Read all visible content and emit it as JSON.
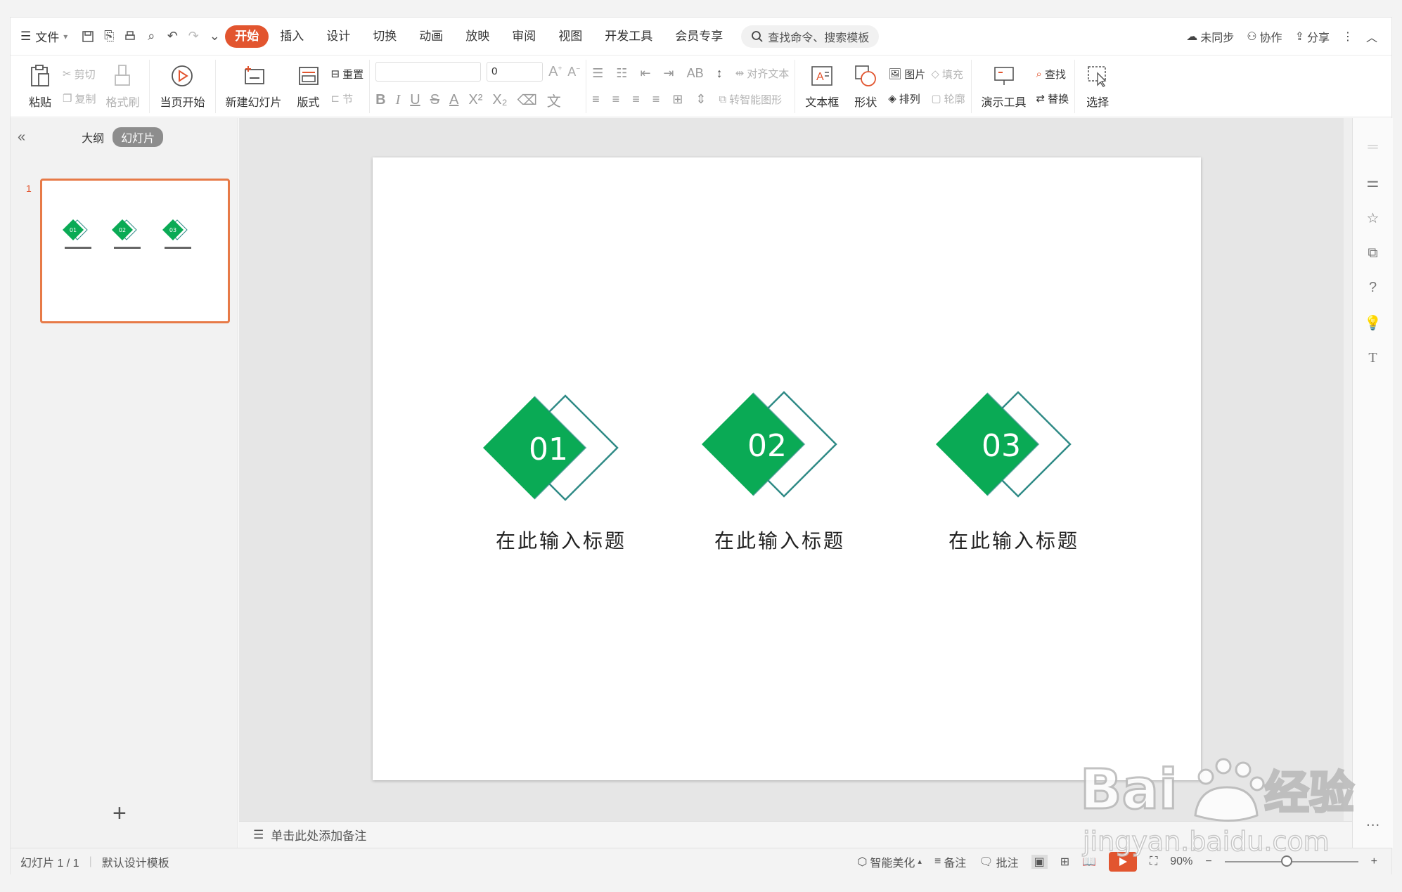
{
  "menubar": {
    "file_label": "文件",
    "tabs": [
      "开始",
      "插入",
      "设计",
      "切换",
      "动画",
      "放映",
      "审阅",
      "视图",
      "开发工具",
      "会员专享"
    ],
    "search_placeholder": "查找命令、搜索模板",
    "sync_label": "未同步",
    "collab_label": "协作",
    "share_label": "分享"
  },
  "ribbon": {
    "paste": "粘贴",
    "cut": "剪切",
    "copy": "复制",
    "format_painter": "格式刷",
    "from_current": "当页开始",
    "new_slide": "新建幻灯片",
    "layout": "版式",
    "reset": "重置",
    "section": "节",
    "font_size_value": "0",
    "align_text": "对齐文本",
    "smart_shape": "转智能图形",
    "textbox": "文本框",
    "shape": "形状",
    "picture": "图片",
    "fill": "填充",
    "arrange": "排列",
    "outline": "轮廓",
    "present_tools": "演示工具",
    "find": "查找",
    "replace": "替换",
    "select": "选择"
  },
  "leftpanel": {
    "outline_tab": "大纲",
    "slides_tab": "幻灯片",
    "slide_number": "1",
    "add_icon": "+"
  },
  "slide": {
    "items": [
      {
        "number": "01",
        "title": "在此输入标题"
      },
      {
        "number": "02",
        "title": "在此输入标题"
      },
      {
        "number": "03",
        "title": "在此输入标题"
      }
    ],
    "colors": {
      "green": "#0aaa55",
      "teal": "#2f8a86"
    }
  },
  "notes": {
    "placeholder": "单击此处添加备注"
  },
  "statusbar": {
    "slide_count": "幻灯片 1 / 1",
    "template": "默认设计模板",
    "smart_beautify": "智能美化",
    "notes_btn": "备注",
    "comment_btn": "批注",
    "zoom": "90%"
  },
  "watermark": {
    "brand": "Bai",
    "brand2": "经验",
    "url": "jingyan.baidu.com"
  }
}
